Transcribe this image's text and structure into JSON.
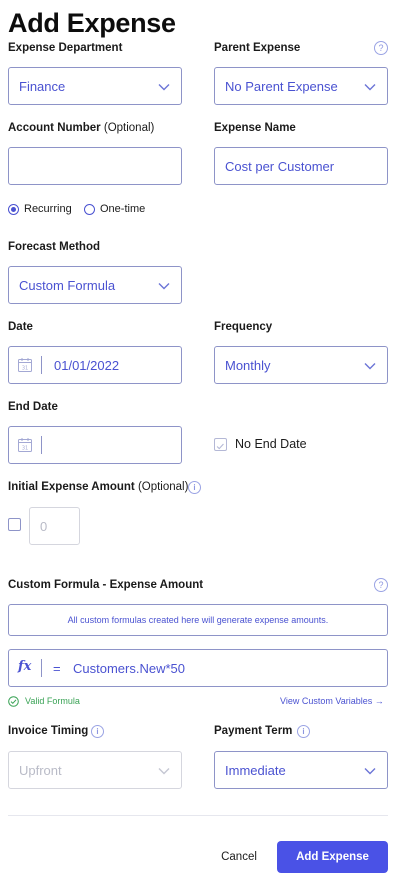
{
  "page": {
    "title": "Add Expense"
  },
  "colors": {
    "accent": "#4a52e6",
    "text_accent": "#4a52d1",
    "valid": "#3aa356"
  },
  "icons": {
    "help": "question-circle-icon",
    "info": "info-circle-icon",
    "calendar": "calendar-icon",
    "formula": "fx-icon",
    "chevron": "chevron-down-icon"
  },
  "expense_department": {
    "label": "Expense Department",
    "value": "Finance"
  },
  "parent_expense": {
    "label": "Parent Expense",
    "value": "No Parent Expense",
    "help": "?"
  },
  "account_number": {
    "label": "Account Number",
    "optional": "(Optional)",
    "value": ""
  },
  "expense_name": {
    "label": "Expense Name",
    "value": "Cost per Customer"
  },
  "recurrence": {
    "options": [
      "Recurring",
      "One-time"
    ],
    "selected": "Recurring"
  },
  "forecast_method": {
    "label": "Forecast Method",
    "value": "Custom Formula"
  },
  "date": {
    "label": "Date",
    "value": "01/01/2022",
    "icon_text": "31"
  },
  "frequency": {
    "label": "Frequency",
    "value": "Monthly"
  },
  "end_date": {
    "label": "End Date",
    "value": "",
    "icon_text": "31"
  },
  "no_end_date": {
    "label": "No End Date",
    "checked": true
  },
  "initial_amount": {
    "label": "Initial Expense Amount",
    "optional": "(Optional)",
    "info": "i",
    "placeholder": "0",
    "checked": false
  },
  "custom_formula": {
    "label": "Custom Formula - Expense Amount",
    "help": "?",
    "note": "All custom formulas created here will generate expense amounts.",
    "fx": "fx",
    "equals": "=",
    "formula": "Customers.New*50",
    "valid_text": "Valid Formula",
    "view_vars": "View Custom Variables →"
  },
  "invoice_timing": {
    "label": "Invoice Timing",
    "info": "i",
    "value": "Upfront",
    "disabled": true
  },
  "payment_term": {
    "label": "Payment Term",
    "info": "i",
    "value": "Immediate"
  },
  "actions": {
    "cancel": "Cancel",
    "submit": "Add Expense"
  }
}
